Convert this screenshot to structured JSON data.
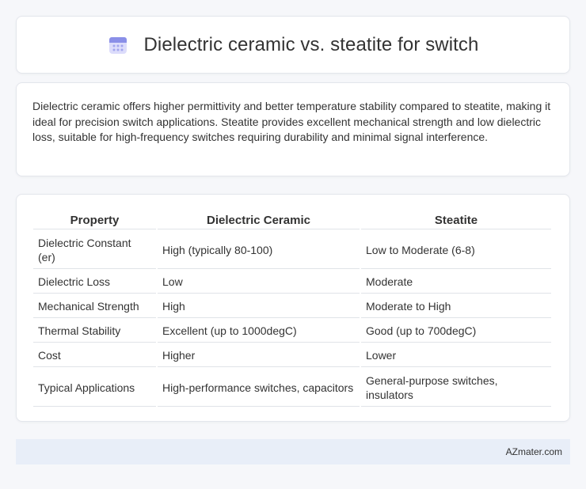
{
  "header": {
    "icon": "calendar-icon",
    "title": "Dielectric ceramic vs. steatite for switch"
  },
  "summary": {
    "text": "Dielectric ceramic offers higher permittivity and better temperature stability compared to steatite, making it ideal for precision switch applications. Steatite provides excellent mechanical strength and low dielectric loss, suitable for high-frequency switches requiring durability and minimal signal interference."
  },
  "table": {
    "headers": [
      "Property",
      "Dielectric Ceramic",
      "Steatite"
    ],
    "rows": [
      [
        "Dielectric Constant (er)",
        "High (typically 80-100)",
        "Low to Moderate (6-8)"
      ],
      [
        "Dielectric Loss",
        "Low",
        "Moderate"
      ],
      [
        "Mechanical Strength",
        "High",
        "Moderate to High"
      ],
      [
        "Thermal Stability",
        "Excellent (up to 1000degC)",
        "Good (up to 700degC)"
      ],
      [
        "Cost",
        "Higher",
        "Lower"
      ],
      [
        "Typical Applications",
        "High-performance switches, capacitors",
        "General-purpose switches, insulators"
      ]
    ]
  },
  "footer": {
    "text": "AZmater.com"
  },
  "colors": {
    "background": "#f6f7fa",
    "footer_bg": "#e8eef8",
    "icon_accent": "#8a8fe8"
  }
}
